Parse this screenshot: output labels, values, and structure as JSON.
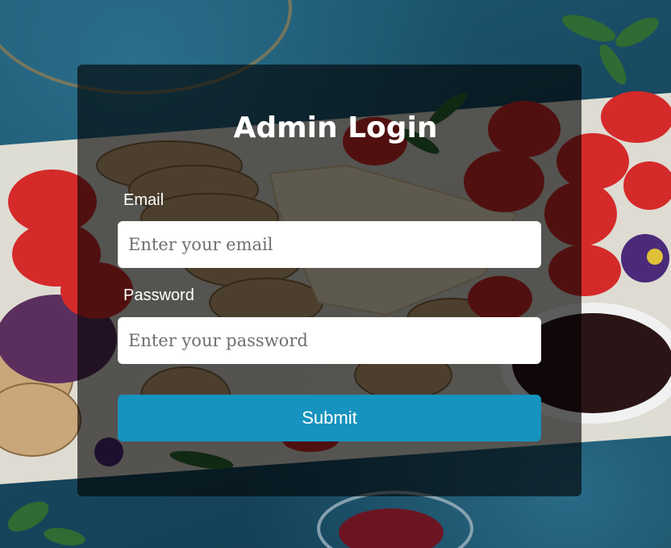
{
  "login": {
    "title": "Admin Login",
    "email_label": "Email",
    "email_placeholder": "Enter your email",
    "password_label": "Password",
    "password_placeholder": "Enter your password",
    "submit_label": "Submit"
  },
  "colors": {
    "card_overlay": "rgba(0,0,0,0.62)",
    "submit_button": "#1693be",
    "input_background": "#ffffff",
    "text": "#ffffff"
  }
}
